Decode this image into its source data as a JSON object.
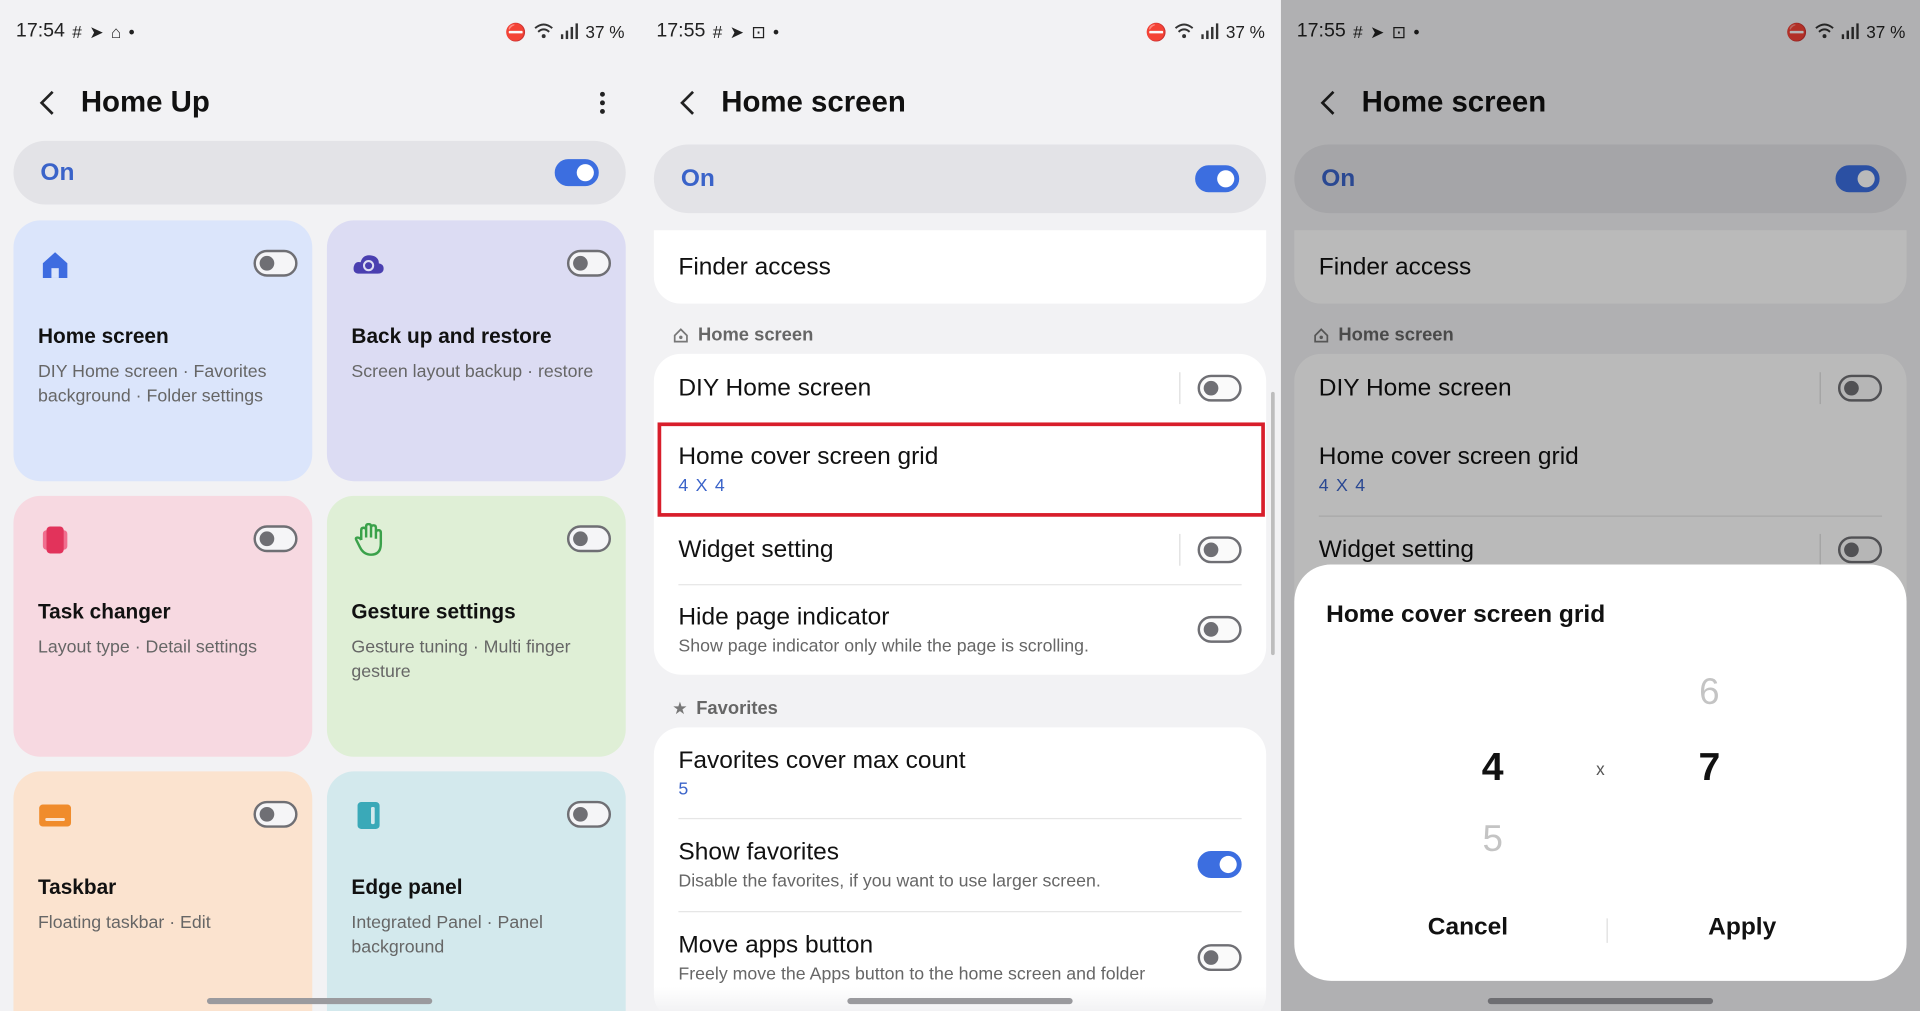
{
  "p1": {
    "status": {
      "time": "17:54",
      "battery": "37 %"
    },
    "title": "Home Up",
    "on_label": "On",
    "cards": [
      {
        "title": "Home screen",
        "subtitle": "DIY Home screen · Favorites background · Folder settings",
        "icon": "home-icon",
        "color": "#dbe5fb"
      },
      {
        "title": "Back up and restore",
        "subtitle": "Screen layout backup · restore",
        "icon": "cloud-sync-icon",
        "color": "#dcdcf3"
      },
      {
        "title": "Task changer",
        "subtitle": "Layout type · Detail settings",
        "icon": "task-changer-icon",
        "color": "#f7d9e1"
      },
      {
        "title": "Gesture settings",
        "subtitle": "Gesture tuning · Multi finger gesture",
        "icon": "hand-icon",
        "color": "#dfefd6"
      },
      {
        "title": "Taskbar",
        "subtitle": "Floating taskbar · Edit",
        "icon": "taskbar-icon",
        "color": "#fbe3cf"
      },
      {
        "title": "Edge panel",
        "subtitle": "Integrated Panel · Panel background",
        "icon": "edge-panel-icon",
        "color": "#d3e9ed"
      }
    ]
  },
  "p2": {
    "status": {
      "time": "17:55",
      "battery": "37 %"
    },
    "title": "Home screen",
    "on_label": "On",
    "finder": "Finder access",
    "section_home": "Home screen",
    "diy": "DIY Home screen",
    "grid_title": "Home cover screen grid",
    "grid_value": "4 X 4",
    "widget": "Widget setting",
    "hide_title": "Hide page indicator",
    "hide_sub": "Show page indicator only while the page is scrolling.",
    "section_fav": "Favorites",
    "fav_max_title": "Favorites cover max count",
    "fav_max_value": "5",
    "show_fav_title": "Show favorites",
    "show_fav_sub": "Disable the favorites, if you want to use larger screen.",
    "move_title": "Move apps button",
    "move_sub": "Freely move the Apps button to the home screen and folder"
  },
  "p3": {
    "status": {
      "time": "17:55",
      "battery": "37 %"
    },
    "title": "Home screen",
    "on_label": "On",
    "finder": "Finder access",
    "section_home": "Home screen",
    "diy": "DIY Home screen",
    "grid_title": "Home cover screen grid",
    "grid_value": "4 X 4",
    "widget": "Widget setting",
    "dialog": {
      "title": "Home cover screen grid",
      "col_selected": "4",
      "col_next": "5",
      "times": "x",
      "row_prev": "6",
      "row_selected": "7",
      "cancel": "Cancel",
      "apply": "Apply"
    }
  }
}
